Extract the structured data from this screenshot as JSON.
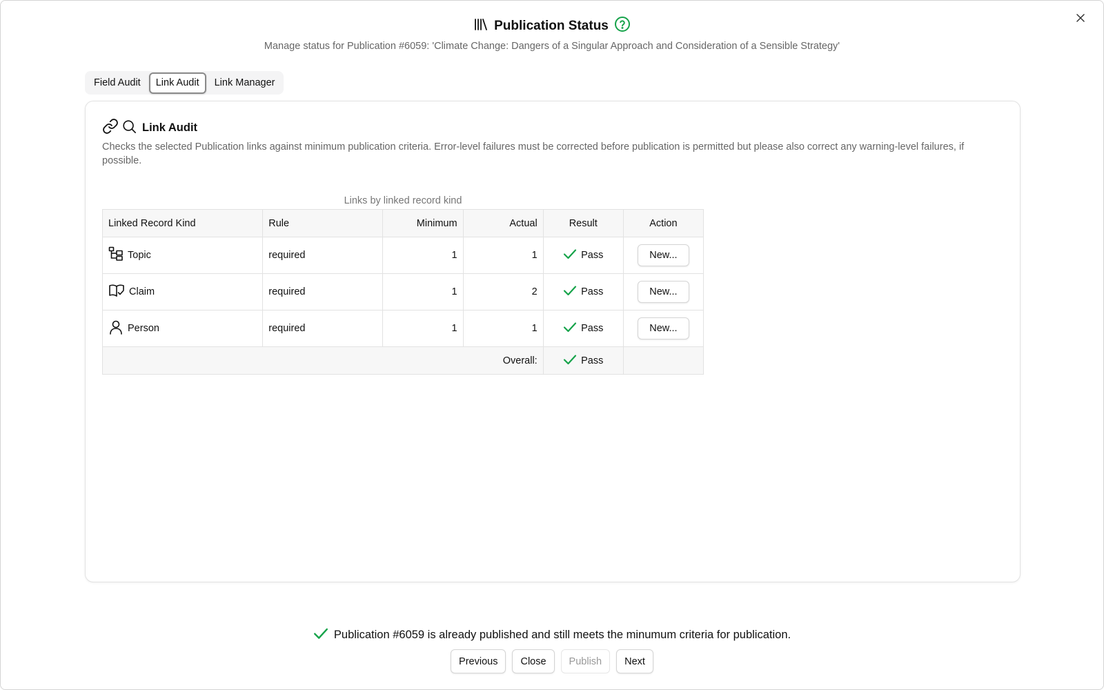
{
  "header": {
    "title": "Publication Status",
    "subtitle": "Manage status for Publication #6059: 'Climate Change: Dangers of a Singular Approach and Consideration of a Sensible Strategy'"
  },
  "tabs": [
    {
      "label": "Field Audit",
      "active": false
    },
    {
      "label": "Link Audit",
      "active": true
    },
    {
      "label": "Link Manager",
      "active": false
    }
  ],
  "card": {
    "title": "Link Audit",
    "description": "Checks the selected Publication links against minimum publication criteria. Error-level failures must be corrected before publication is permitted but please also correct any warning-level failures, if possible."
  },
  "table": {
    "caption": "Links by linked record kind",
    "columns": [
      "Linked Record Kind",
      "Rule",
      "Minimum",
      "Actual",
      "Result",
      "Action"
    ],
    "rows": [
      {
        "kind": "Topic",
        "icon": "topic-tree-icon",
        "rule": "required",
        "minimum": "1",
        "actual": "1",
        "result": "Pass",
        "action": "New..."
      },
      {
        "kind": "Claim",
        "icon": "claim-book-icon",
        "rule": "required",
        "minimum": "1",
        "actual": "2",
        "result": "Pass",
        "action": "New..."
      },
      {
        "kind": "Person",
        "icon": "person-icon",
        "rule": "required",
        "minimum": "1",
        "actual": "1",
        "result": "Pass",
        "action": "New..."
      }
    ],
    "overall_label": "Overall:",
    "overall_result": "Pass"
  },
  "status_message": "Publication #6059 is already published and still meets the minumum criteria for publication.",
  "footer": {
    "previous": "Previous",
    "close": "Close",
    "publish": "Publish",
    "next": "Next"
  },
  "colors": {
    "success": "#16a34a",
    "border": "#e2e2e2",
    "muted_text": "#666666"
  }
}
